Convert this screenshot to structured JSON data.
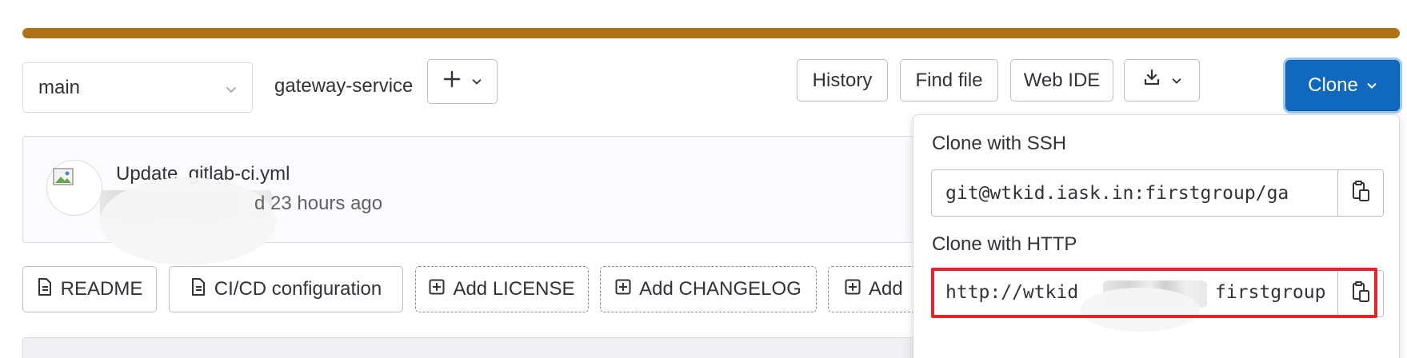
{
  "colors": {
    "progress_bar": "#b07219",
    "primary": "#1068bf",
    "highlight_border": "#e8212b"
  },
  "toolbar": {
    "branch": "main",
    "project": "gateway-service",
    "separator": "/",
    "add_icon": "plus-icon",
    "history": "History",
    "find_file": "Find file",
    "web_ide": "Web IDE",
    "download_icon": "download-icon",
    "clone": "Clone"
  },
  "commit": {
    "title": "Update .gitlab-ci.yml",
    "meta_suffix": "d 23 hours ago"
  },
  "quick_actions": [
    {
      "label": "README",
      "icon": "file-icon"
    },
    {
      "label": "CI/CD configuration",
      "icon": "file-icon"
    },
    {
      "label": "Add LICENSE",
      "icon": "plus-square-icon"
    },
    {
      "label": "Add CHANGELOG",
      "icon": "plus-square-icon"
    },
    {
      "label": "Add",
      "icon": "plus-square-icon"
    }
  ],
  "clone_dropdown": {
    "ssh_heading": "Clone with SSH",
    "ssh_url": "git@wtkid.iask.in:firstgroup/ga",
    "http_heading": "Clone with HTTP",
    "http_url_prefix": "http://wtkid",
    "http_url_suffix": "firstgroup",
    "copy_icon": "clipboard-icon"
  }
}
